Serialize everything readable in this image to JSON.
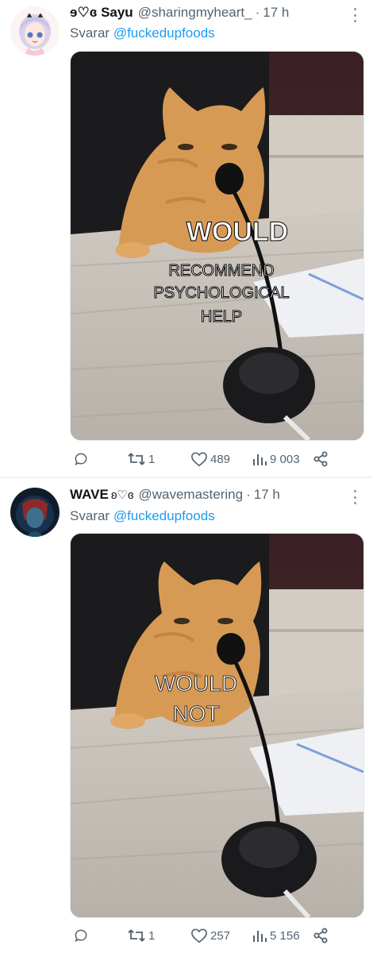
{
  "tweets": [
    {
      "display_name": "ɘ♡ɞ Sayu",
      "handle": "@sharingmyheart_",
      "separator": "·",
      "time": "17 h",
      "reply_prefix": "Svarar",
      "reply_to": "@fuckedupfoods",
      "meme_text": [
        "WOULD",
        "RECOMMEND",
        "PSYCHOLOGICAL",
        "HELP"
      ],
      "actions": {
        "replies": "",
        "retweets": "1",
        "likes": "489",
        "views": "9 003"
      }
    },
    {
      "display_name": "WAVE",
      "name_glyphs": "ʚ♡ɞ",
      "handle": "@wavemastering",
      "separator": "·",
      "time": "17 h",
      "reply_prefix": "Svarar",
      "reply_to": "@fuckedupfoods",
      "meme_text": [
        "WOULD",
        "NOT"
      ],
      "actions": {
        "replies": "",
        "retweets": "1",
        "likes": "257",
        "views": "5 156"
      }
    }
  ],
  "colors": {
    "link": "#1d9bf0",
    "muted": "#536471",
    "text": "#0f1419"
  },
  "icons": [
    "reply-icon",
    "retweet-icon",
    "heart-icon",
    "views-icon",
    "share-icon",
    "more-icon"
  ]
}
